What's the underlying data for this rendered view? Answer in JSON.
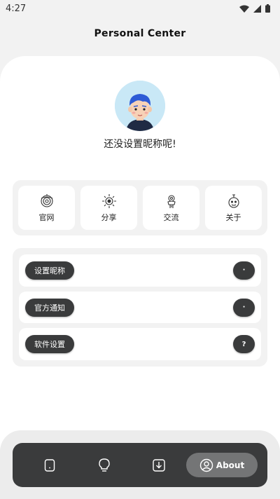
{
  "status_bar": {
    "time": "4:27"
  },
  "header": {
    "title": "Personal Center"
  },
  "profile": {
    "nickname": "还没设置昵称呢!"
  },
  "quick_actions": [
    {
      "label": "官网",
      "icon": "website-icon"
    },
    {
      "label": "分享",
      "icon": "share-icon"
    },
    {
      "label": "交流",
      "icon": "community-icon"
    },
    {
      "label": "关于",
      "icon": "about-icon"
    }
  ],
  "settings_list": [
    {
      "label": "设置昵称",
      "action": "·"
    },
    {
      "label": "官方通知",
      "action": "·"
    },
    {
      "label": "软件设置",
      "action": "?"
    }
  ],
  "bottom_nav": {
    "items": [
      "phone-icon",
      "bulb-icon",
      "download-icon"
    ],
    "active_label": "About",
    "active_icon": "user-circle-icon"
  },
  "colors": {
    "dark": "#3a3b3c",
    "active_tab": "#747576",
    "avatar_bg": "#c9e8f6"
  }
}
